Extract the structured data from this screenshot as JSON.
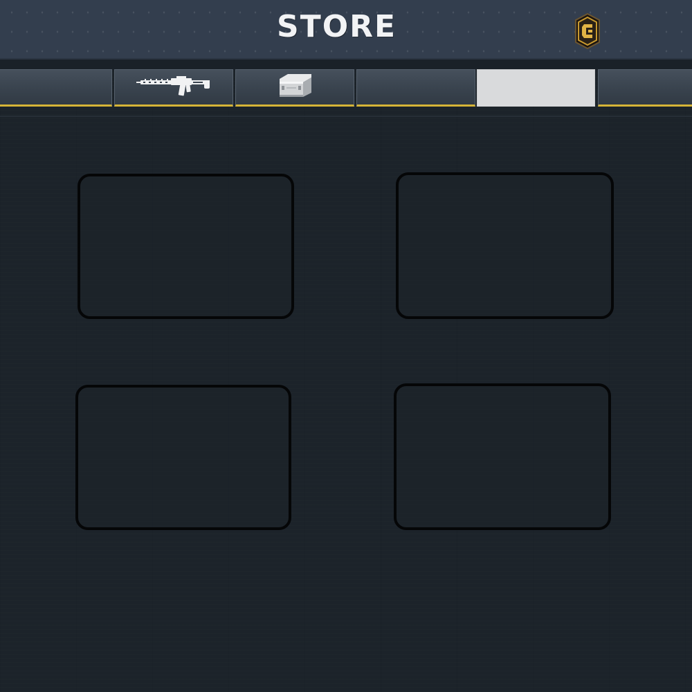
{
  "header": {
    "title": "STORE",
    "currency_icon": "renown-credits-icon"
  },
  "tabs": [
    {
      "id": "tab-1",
      "icon": "",
      "active": false
    },
    {
      "id": "tab-2",
      "icon": "assault-rifle-icon",
      "active": false
    },
    {
      "id": "tab-3",
      "icon": "supply-crate-icon",
      "active": false
    },
    {
      "id": "tab-4",
      "icon": "",
      "active": false
    },
    {
      "id": "tab-5",
      "icon": "",
      "active": true
    },
    {
      "id": "tab-6",
      "icon": "",
      "active": false
    }
  ],
  "store_slots": [
    {
      "id": "slot-1",
      "label": ""
    },
    {
      "id": "slot-2",
      "label": ""
    },
    {
      "id": "slot-3",
      "label": ""
    },
    {
      "id": "slot-4",
      "label": ""
    }
  ],
  "colors": {
    "header_bg": "#333e4e",
    "tab_accent": "#d6b437",
    "active_tab": "#d9dadc",
    "page_bg": "#1c232a",
    "slot_border": "#050607",
    "credits_gold": "#c99a2e"
  }
}
